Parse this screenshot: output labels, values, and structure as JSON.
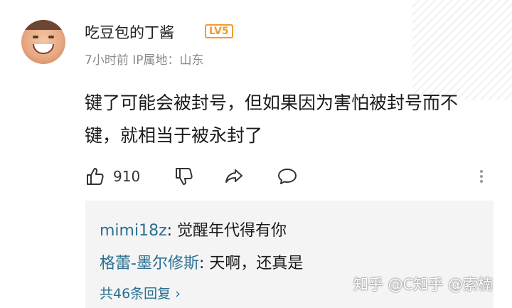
{
  "comment": {
    "username": "吃豆包的丁酱",
    "level": "LV5",
    "meta": "7小时前  IP属地：山东",
    "text": "键了可能会被封号，但如果因为害怕被封号而不键，就相当于被永封了",
    "like_count": "910"
  },
  "icons": {
    "like": "thumbs-up-icon",
    "dislike": "thumbs-down-icon",
    "share": "share-icon",
    "reply": "comment-bubble-icon",
    "more": "more-vertical-icon"
  },
  "replies": [
    {
      "author": "mimi18z",
      "text": "觉醒年代得有你"
    },
    {
      "author": "格蕾-墨尔修斯",
      "text": "天啊，还真是"
    }
  ],
  "view_more": "共46条回复 ›",
  "watermark": "知乎 @C知乎 @索楠",
  "colors": {
    "link": "#2a6f8f",
    "badge": "#f29a2e",
    "reply_bg": "#f4f4f4"
  }
}
